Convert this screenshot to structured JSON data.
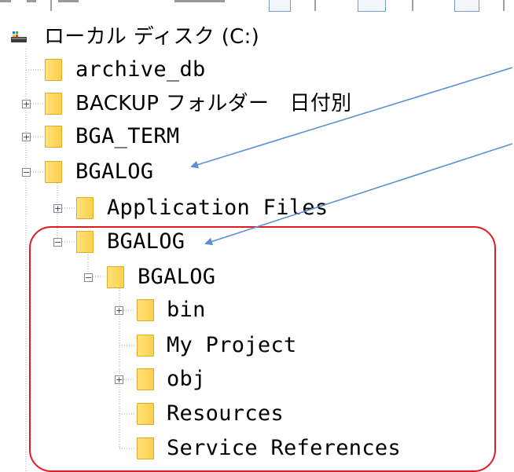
{
  "tree": {
    "root": {
      "label": "ローカル ディスク (C:)",
      "icon": "drive-icon"
    },
    "items": [
      {
        "label": "archive_db",
        "expander": "",
        "icon": "folder-icon"
      },
      {
        "label": "BACKUP フォルダー　日付別",
        "expander": "+",
        "icon": "folder-icon"
      },
      {
        "label": "BGA_TERM",
        "expander": "+",
        "icon": "folder-icon"
      },
      {
        "label": "BGALOG",
        "expander": "−",
        "icon": "folder-icon"
      },
      {
        "label": "Application Files",
        "expander": "+",
        "icon": "folder-icon"
      },
      {
        "label": "BGALOG",
        "expander": "−",
        "icon": "folder-icon"
      },
      {
        "label": "BGALOG",
        "expander": "−",
        "icon": "folder-icon"
      },
      {
        "label": "bin",
        "expander": "+",
        "icon": "folder-icon"
      },
      {
        "label": "My Project",
        "expander": "",
        "icon": "folder-icon"
      },
      {
        "label": "obj",
        "expander": "+",
        "icon": "folder-icon"
      },
      {
        "label": "Resources",
        "expander": "",
        "icon": "folder-icon"
      },
      {
        "label": "Service References",
        "expander": "",
        "icon": "folder-icon"
      }
    ]
  },
  "annotations": {
    "callout_box_color": "#e11b22",
    "arrow_color": "#5b8fd0"
  }
}
